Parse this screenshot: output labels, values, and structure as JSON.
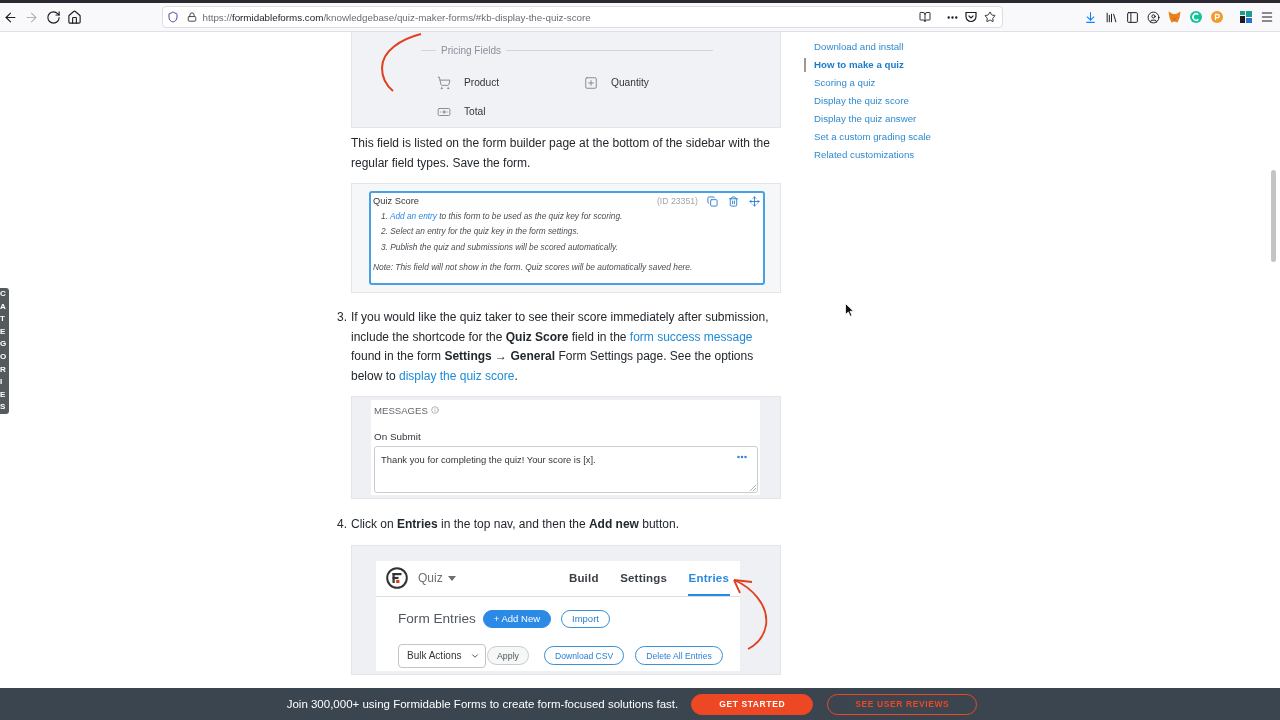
{
  "browser": {
    "nav": [
      {
        "kind": "back",
        "disabled": false
      },
      {
        "kind": "forward",
        "disabled": true
      },
      {
        "kind": "reload",
        "disabled": false
      },
      {
        "kind": "home",
        "disabled": false
      }
    ],
    "url": {
      "scheme": "https://",
      "host": "formidableforms.com",
      "path": "/knowledgebase/quiz-maker-forms/#kb-display-the-quiz-score"
    }
  },
  "side_tab": {
    "label": "CATEGORIES"
  },
  "article": {
    "blocks": [
      {
        "kind": "pricing_image",
        "heading": "Pricing Fields",
        "fields": [
          {
            "kind": "product",
            "label": "Product"
          },
          {
            "kind": "quantity",
            "label": "Quantity"
          },
          {
            "kind": "total",
            "label": "Total"
          }
        ]
      },
      {
        "kind": "paragraph",
        "segments": [
          {
            "kind": "text",
            "text": "This field is listed on the form builder page at the bottom of the sidebar with the regular field types. Save the form."
          }
        ]
      },
      {
        "kind": "quiz_score_image",
        "title": "Quiz Score",
        "id": "(ID 23351)",
        "steps": [
          {
            "number": "1.",
            "link": "Add an entry",
            "text": "to this form to be used as the quiz key for scoring."
          },
          {
            "number": "2.",
            "text": "Select an entry for the quiz key in the form settings."
          },
          {
            "number": "3.",
            "text": "Publish the quiz and submissions will be scored automatically."
          }
        ],
        "note": "Note: This field will not show in the form. Quiz scores will be automatically saved here."
      },
      {
        "kind": "step",
        "number": "3.",
        "segments": [
          {
            "kind": "text",
            "text": "If you would like the quiz taker to see their score immediately after submission, include the shortcode for the **Quiz Score** field in the "
          },
          {
            "kind": "link",
            "text": "form success message"
          },
          {
            "kind": "text",
            "text": " found in the form **Settings → General** Form Settings page. See the options below to "
          },
          {
            "kind": "link",
            "text": "display the quiz score"
          },
          {
            "kind": "text",
            "text": "."
          }
        ]
      },
      {
        "kind": "messages_image",
        "heading": "MESSAGES",
        "label": "On Submit",
        "value": "Thank you for completing the quiz! Your score is [x]."
      },
      {
        "kind": "step",
        "number": "4.",
        "segments": [
          {
            "kind": "text",
            "text": "Click on **Entries** in the top nav, and then the **Add new** button."
          }
        ]
      },
      {
        "kind": "entries_image",
        "form_name": "Quiz",
        "tabs": [
          {
            "label": "Build",
            "selected": false
          },
          {
            "label": "Settings",
            "selected": false
          },
          {
            "label": "Entries",
            "selected": true
          }
        ],
        "title": "Form Entries",
        "buttons": [
          {
            "kind": "primary",
            "label": "+ Add New"
          },
          {
            "kind": "outline",
            "label": "Import"
          }
        ],
        "bulk_select": "Bulk Actions",
        "apply": "Apply",
        "actions": [
          "Download CSV",
          "Delete All Entries"
        ]
      }
    ]
  },
  "toc": {
    "items": [
      {
        "label": "Download and install",
        "selected": false
      },
      {
        "label": "How to make a quiz",
        "selected": true
      },
      {
        "label": "Scoring a quiz",
        "selected": false
      },
      {
        "label": "Display the quiz score",
        "selected": false
      },
      {
        "label": "Display the quiz answer",
        "selected": false
      },
      {
        "label": "Set a custom grading scale",
        "selected": false
      },
      {
        "label": "Related customizations",
        "selected": false
      }
    ]
  },
  "promo_bar": {
    "text": "Join 300,000+ using Formidable Forms to create form-focused solutions fast.",
    "buttons": [
      {
        "kind": "primary",
        "label": "GET STARTED"
      },
      {
        "kind": "outline",
        "label": "SEE USER REVIEWS"
      }
    ]
  }
}
